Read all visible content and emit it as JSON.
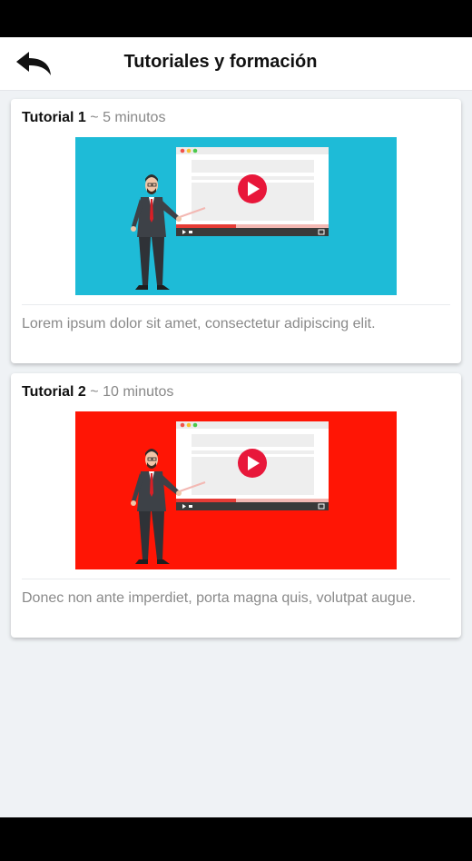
{
  "header": {
    "title": "Tutoriales y formación",
    "back_icon": "back-arrow-icon"
  },
  "tutorials": [
    {
      "title": "Tutorial 1",
      "separator": "~",
      "duration": "5 minutos",
      "description": "Lorem ipsum dolor sit amet, consectetur adipiscing elit.",
      "background_color": "#1ebbd7"
    },
    {
      "title": "Tutorial 2",
      "separator": "~",
      "duration": "10 minutos",
      "description": "Donec non ante imperdiet, porta magna quis, volutpat augue.",
      "background_color": "#ff1505"
    }
  ],
  "colors": {
    "page_background": "#eff2f5",
    "play_button": "#e8173a",
    "presenter_tie": "#d91f26"
  }
}
